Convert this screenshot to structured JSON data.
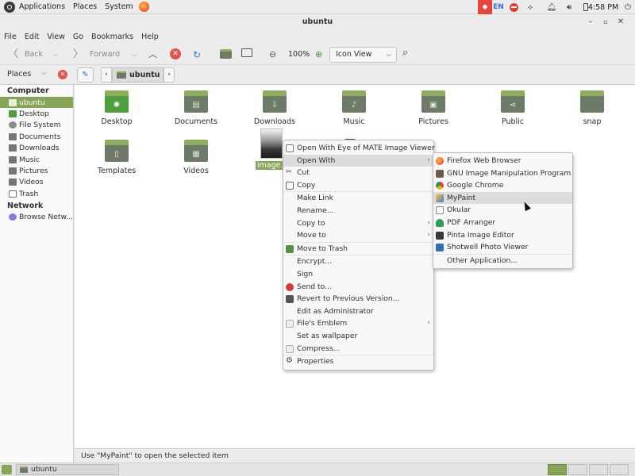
{
  "top_panel": {
    "applications": "Applications",
    "places": "Places",
    "system": "System",
    "keyboard_layout": "EN",
    "clock": "4:58 PM"
  },
  "window": {
    "title": "ubuntu"
  },
  "menubar": [
    "File",
    "Edit",
    "View",
    "Go",
    "Bookmarks",
    "Help"
  ],
  "toolbar": {
    "back": "Back",
    "forward": "Forward",
    "zoom": "100%",
    "view_mode": "Icon View"
  },
  "locationbar": {
    "places_label": "Places",
    "path_segment": "ubuntu"
  },
  "sidebar": {
    "computer_heading": "Computer",
    "computer_items": [
      "ubuntu",
      "Desktop",
      "File System",
      "Documents",
      "Downloads",
      "Music",
      "Pictures",
      "Videos",
      "Trash"
    ],
    "network_heading": "Network",
    "network_items": [
      "Browse Netw..."
    ]
  },
  "files": {
    "desktop": "Desktop",
    "documents": "Documents",
    "downloads": "Downloads",
    "music": "Music",
    "pictures": "Pictures",
    "public": "Public",
    "snap": "snap",
    "templates": "Templates",
    "videos": "Videos",
    "image": "image.j"
  },
  "context_menu": {
    "open_with_eog": "Open With Eye of MATE Image Viewer",
    "open_with": "Open With",
    "cut": "Cut",
    "copy": "Copy",
    "make_link": "Make Link",
    "rename": "Rename...",
    "copy_to": "Copy to",
    "move_to": "Move to",
    "move_to_trash": "Move to Trash",
    "encrypt": "Encrypt...",
    "sign": "Sign",
    "send_to": "Send to...",
    "revert": "Revert to Previous Version...",
    "edit_admin": "Edit as Administrator",
    "emblem": "File's Emblem",
    "wallpaper": "Set as wallpaper",
    "compress": "Compress...",
    "properties": "Properties"
  },
  "submenu": {
    "firefox": "Firefox Web Browser",
    "gimp": "GNU Image Manipulation Program",
    "chrome": "Google Chrome",
    "mypaint": "MyPaint",
    "okular": "Okular",
    "pdf_arranger": "PDF Arranger",
    "pinta": "Pinta Image Editor",
    "shotwell": "Shotwell Photo Viewer",
    "other": "Other Application..."
  },
  "statusbar": {
    "message": "Use \"MyPaint\" to open the selected item"
  },
  "taskbar": {
    "window_button": "ubuntu"
  },
  "colors": {
    "accent": "#87a556",
    "folder": "#6e7a68"
  }
}
